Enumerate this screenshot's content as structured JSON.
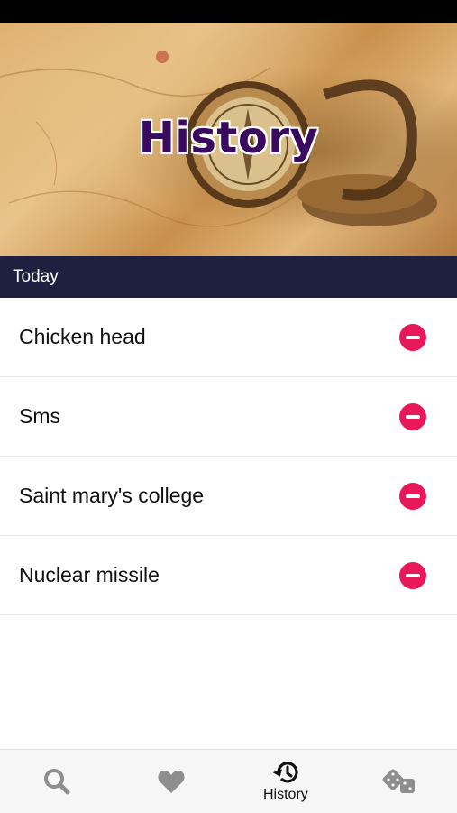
{
  "header": {
    "title": "History"
  },
  "section": {
    "label": "Today"
  },
  "history_items": [
    {
      "label": "Chicken head"
    },
    {
      "label": "Sms"
    },
    {
      "label": "Saint mary's college"
    },
    {
      "label": "Nuclear missile"
    }
  ],
  "tabs": [
    {
      "icon": "search-icon",
      "label": "",
      "active": false
    },
    {
      "icon": "heart-icon",
      "label": "",
      "active": false
    },
    {
      "icon": "history-icon",
      "label": "History",
      "active": true
    },
    {
      "icon": "dice-icon",
      "label": "",
      "active": false
    }
  ],
  "colors": {
    "section_bg": "#1f2040",
    "delete": "#e8185a",
    "title": "#3a0a5e",
    "tab_inactive": "#8e8e8e",
    "tab_active": "#111111"
  }
}
